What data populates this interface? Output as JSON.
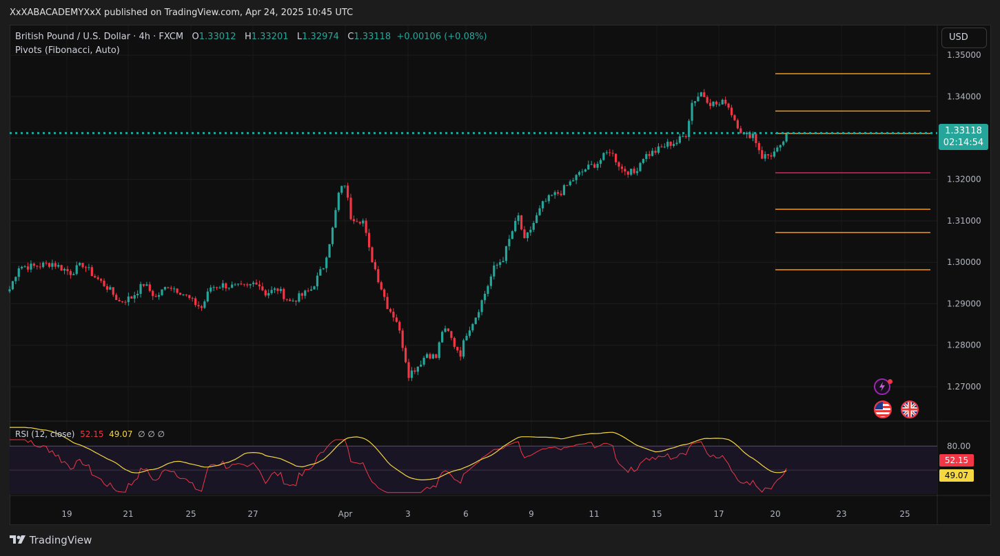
{
  "header": {
    "publish_text": "XxXABACADEMYXxX published on TradingView.com, Apr 24, 2025 10:45 UTC"
  },
  "legend": {
    "symbol": "British Pound / U.S. Dollar · 4h · FXCM",
    "o_label": "O",
    "o_value": "1.33012",
    "h_label": "H",
    "h_value": "1.33201",
    "l_label": "L",
    "l_value": "1.32974",
    "c_label": "C",
    "c_value": "1.33118",
    "change": "+0.00106 (+0.08%)",
    "indicator": "Pivots (Fibonacci, Auto)"
  },
  "currency_button": "USD",
  "price_tag": {
    "price": "1.33118",
    "countdown": "02:14:54"
  },
  "rsi": {
    "label": "RSI (12, close)",
    "value": "52.15",
    "ma_value": "49.07",
    "extras": "∅ ∅ ∅",
    "upper_level": "80.00"
  },
  "footer": {
    "brand": "TradingView"
  },
  "icons": [
    "lightning-icon",
    "us-flag-icon",
    "uk-flag-icon",
    "tradingview-logo-icon"
  ],
  "colors": {
    "up": "#26a69a",
    "down": "#f23645",
    "pivot_orange": "#ff9800",
    "pivot_pink": "#e91e63",
    "rsi_line": "#f23645",
    "rsi_ma": "#f5d742",
    "current_price": "#26a69a"
  },
  "chart_data": {
    "type": "candlestick",
    "symbol": "GBPUSD",
    "timeframe": "4h",
    "y_axis": {
      "ticks": [
        "1.35000",
        "1.34000",
        "1.33000",
        "1.32000",
        "1.31000",
        "1.30000",
        "1.29000",
        "1.28000",
        "1.27000"
      ],
      "range": [
        1.262,
        1.354
      ]
    },
    "x_axis": {
      "ticks": [
        "19",
        "21",
        "25",
        "27",
        "Apr",
        "3",
        "6",
        "9",
        "11",
        "15",
        "17",
        "20",
        "23",
        "25"
      ]
    },
    "current_price": 1.33118,
    "pivot_levels": [
      {
        "value": 1.3455,
        "color": "orange"
      },
      {
        "value": 1.3365,
        "color": "orange"
      },
      {
        "value": 1.3311,
        "color": "orange"
      },
      {
        "value": 1.3216,
        "color": "pink"
      },
      {
        "value": 1.3128,
        "color": "orange"
      },
      {
        "value": 1.3072,
        "color": "orange"
      },
      {
        "value": 1.2982,
        "color": "orange"
      }
    ],
    "waypoints": [
      [
        0,
        1.2935
      ],
      [
        3,
        1.299
      ],
      [
        8,
        1.299
      ],
      [
        14,
        1.2998
      ],
      [
        20,
        1.2975
      ],
      [
        24,
        1.2995
      ],
      [
        28,
        1.2965
      ],
      [
        32,
        1.294
      ],
      [
        36,
        1.2905
      ],
      [
        40,
        1.2915
      ],
      [
        44,
        1.2948
      ],
      [
        48,
        1.2915
      ],
      [
        52,
        1.2945
      ],
      [
        56,
        1.293
      ],
      [
        60,
        1.2905
      ],
      [
        63,
        1.289
      ],
      [
        66,
        1.294
      ],
      [
        70,
        1.2945
      ],
      [
        74,
        1.294
      ],
      [
        78,
        1.294
      ],
      [
        81,
        1.2955
      ],
      [
        84,
        1.2925
      ],
      [
        88,
        1.2935
      ],
      [
        92,
        1.2905
      ],
      [
        96,
        1.292
      ],
      [
        99,
        1.2935
      ],
      [
        103,
        1.299
      ],
      [
        106,
        1.308
      ],
      [
        108,
        1.3165
      ],
      [
        110,
        1.319
      ],
      [
        112,
        1.311
      ],
      [
        116,
        1.31
      ],
      [
        118,
        1.303
      ],
      [
        121,
        1.296
      ],
      [
        124,
        1.2895
      ],
      [
        127,
        1.286
      ],
      [
        129,
        1.28
      ],
      [
        131,
        1.273
      ],
      [
        134,
        1.275
      ],
      [
        137,
        1.278
      ],
      [
        140,
        1.277
      ],
      [
        142,
        1.2835
      ],
      [
        144,
        1.283
      ],
      [
        146,
        1.28
      ],
      [
        148,
        1.278
      ],
      [
        150,
        1.283
      ],
      [
        153,
        1.287
      ],
      [
        156,
        1.2925
      ],
      [
        159,
        1.2985
      ],
      [
        162,
        1.301
      ],
      [
        165,
        1.3075
      ],
      [
        167,
        1.311
      ],
      [
        169,
        1.305
      ],
      [
        172,
        1.3095
      ],
      [
        175,
        1.314
      ],
      [
        178,
        1.316
      ],
      [
        181,
        1.317
      ],
      [
        185,
        1.32
      ],
      [
        189,
        1.3225
      ],
      [
        193,
        1.324
      ],
      [
        197,
        1.327
      ],
      [
        201,
        1.3225
      ],
      [
        205,
        1.3215
      ],
      [
        208,
        1.3255
      ],
      [
        212,
        1.3268
      ],
      [
        216,
        1.3285
      ],
      [
        219,
        1.329
      ],
      [
        222,
        1.331
      ],
      [
        224,
        1.3385
      ],
      [
        227,
        1.341
      ],
      [
        230,
        1.3385
      ],
      [
        233,
        1.338
      ],
      [
        235,
        1.339
      ],
      [
        238,
        1.3345
      ],
      [
        241,
        1.3305
      ],
      [
        244,
        1.331
      ],
      [
        247,
        1.3255
      ],
      [
        250,
        1.326
      ],
      [
        253,
        1.3275
      ],
      [
        255,
        1.3312
      ]
    ],
    "rsi_series": {
      "range": [
        20,
        100
      ],
      "upper": 80,
      "lower": 20,
      "last_rsi": 52.15,
      "last_ma": 49.07
    }
  }
}
